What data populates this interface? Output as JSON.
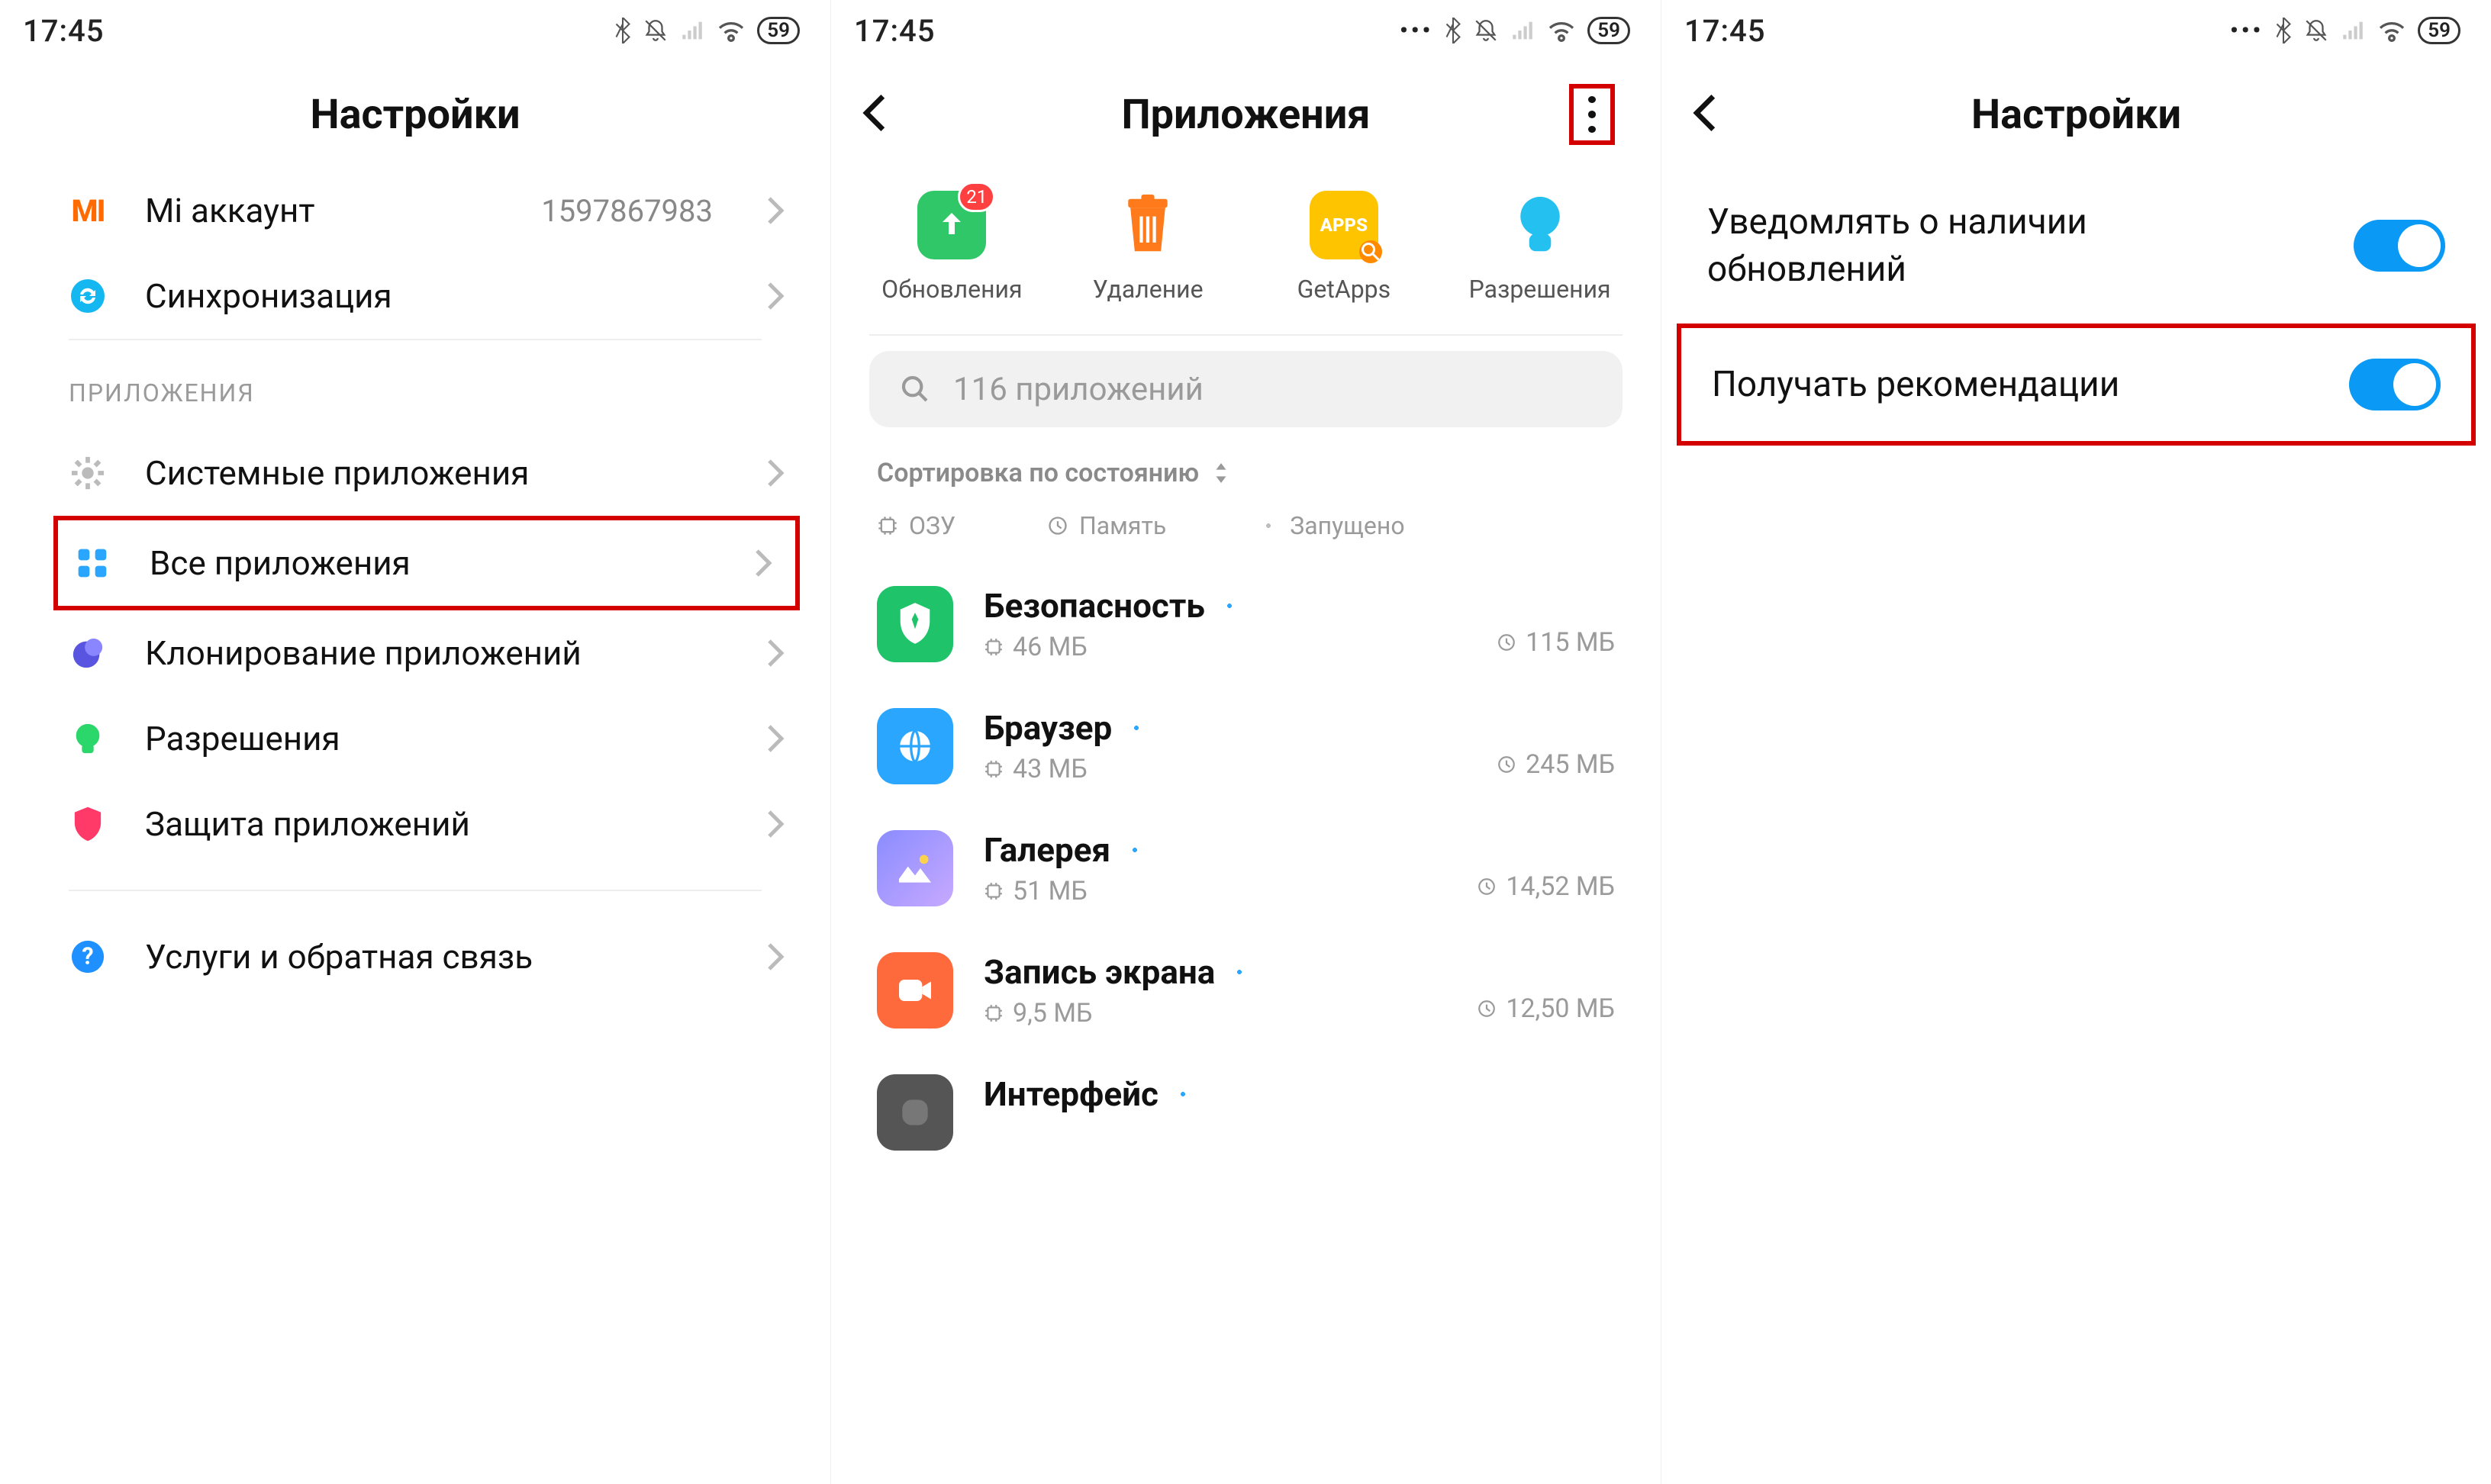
{
  "status": {
    "time": "17:45",
    "battery": "59"
  },
  "screen1": {
    "title": "Настройки",
    "rows": [
      {
        "icon": "mi-logo",
        "label": "Mi аккаунт",
        "value": "1597867983"
      },
      {
        "icon": "sync",
        "label": "Синхронизация"
      }
    ],
    "section": "ПРИЛОЖЕНИЯ",
    "apps_section": [
      {
        "icon": "gear",
        "label": "Системные приложения"
      },
      {
        "icon": "grid",
        "label": "Все приложения",
        "highlight": true
      },
      {
        "icon": "clone",
        "label": "Клонирование приложений"
      },
      {
        "icon": "perm",
        "label": "Разрешения"
      },
      {
        "icon": "shield",
        "label": "Защита приложений"
      }
    ],
    "bottom": {
      "icon": "help",
      "label": "Услуги и обратная связь"
    }
  },
  "screen2": {
    "title": "Приложения",
    "shortcuts": [
      {
        "label": "Обновления",
        "badge": "21",
        "color": "#30c768"
      },
      {
        "label": "Удаление",
        "color": "#ff7a1a"
      },
      {
        "label": "GetApps",
        "color": "#ffc400"
      },
      {
        "label": "Разрешения",
        "color": "#23c0f0"
      }
    ],
    "search_placeholder": "116 приложений",
    "sort_label": "Сортировка по состоянию",
    "filters": {
      "ram": "ОЗУ",
      "storage": "Память",
      "running": "Запущено"
    },
    "apps": [
      {
        "name": "Безопасность",
        "ram": "46 МБ",
        "storage": "115 МБ",
        "bg": "#1ec36a"
      },
      {
        "name": "Браузер",
        "ram": "43 МБ",
        "storage": "245 МБ",
        "bg": "#2aa6ff"
      },
      {
        "name": "Галерея",
        "ram": "51 МБ",
        "storage": "14,52 МБ",
        "bg": "#8a8cff"
      },
      {
        "name": "Запись экрана",
        "ram": "9,5 МБ",
        "storage": "12,50 МБ",
        "bg": "#ff6a3d"
      },
      {
        "name": "Интерфейс",
        "ram": "",
        "storage": "",
        "bg": "#555"
      }
    ]
  },
  "screen3": {
    "title": "Настройки",
    "toggles": [
      {
        "label": "Уведомлять о наличии обновлений",
        "on": true
      },
      {
        "label": "Получать рекомендации",
        "on": true,
        "highlight": true
      }
    ]
  }
}
